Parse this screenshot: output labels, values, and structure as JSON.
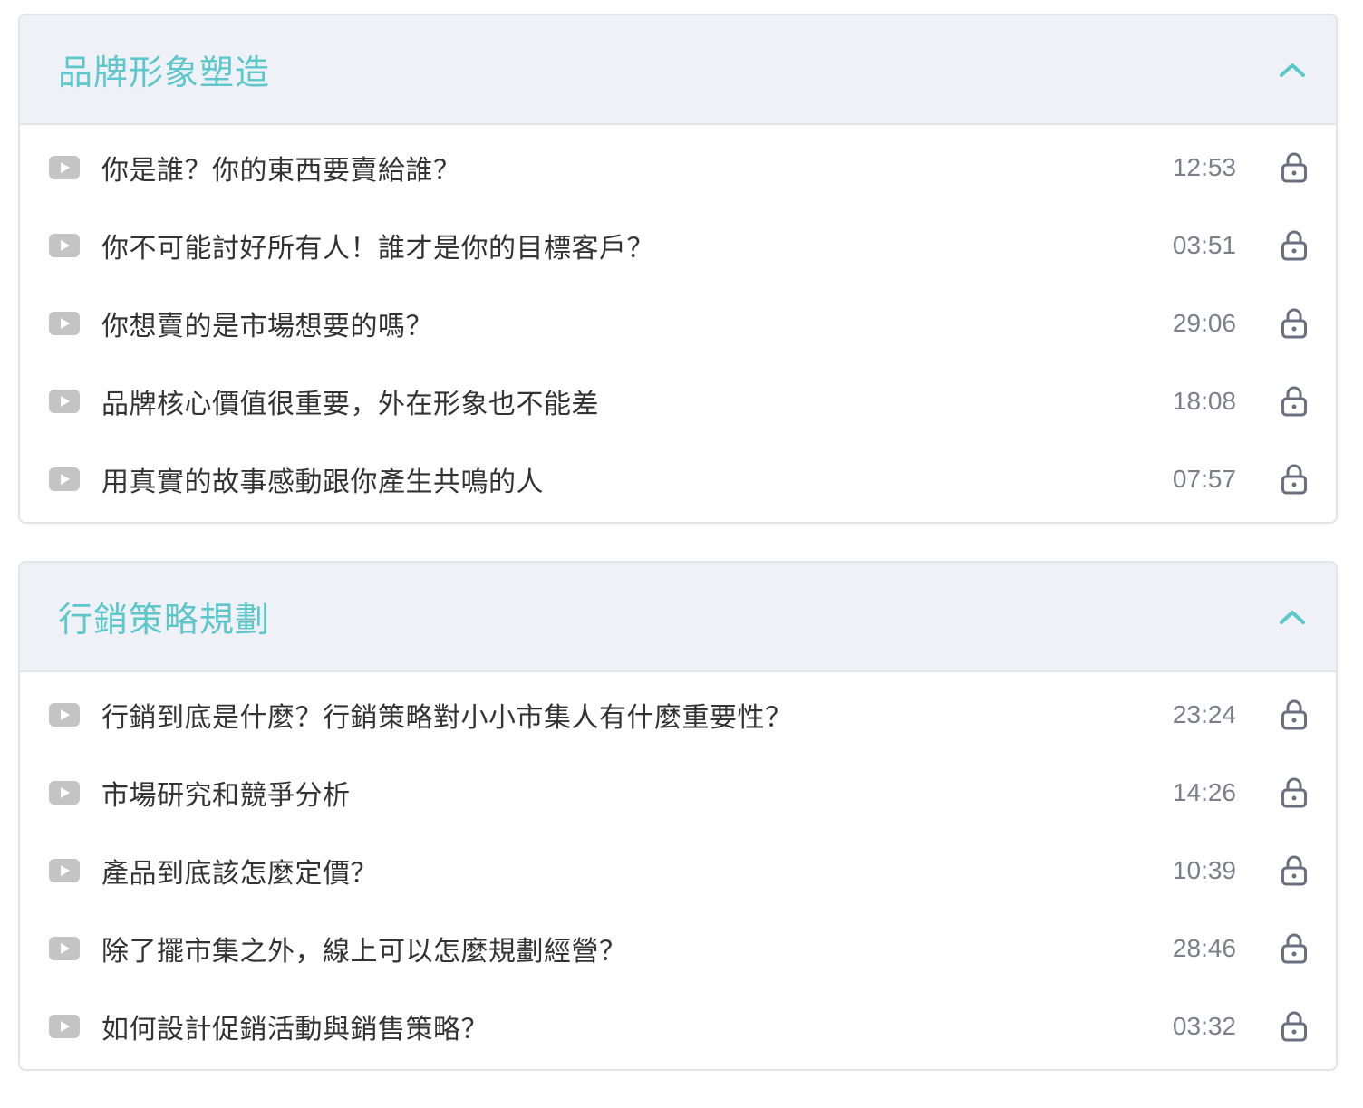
{
  "sections": [
    {
      "title": "品牌形象塑造",
      "collapse_icon": "chevron-up-icon",
      "lessons": [
        {
          "title": "你是誰？你的東西要賣給誰？",
          "duration": "12:53"
        },
        {
          "title": "你不可能討好所有人！誰才是你的目標客戶？",
          "duration": "03:51"
        },
        {
          "title": "你想賣的是市場想要的嗎？",
          "duration": "29:06"
        },
        {
          "title": "品牌核心價值很重要，外在形象也不能差",
          "duration": "18:08"
        },
        {
          "title": "用真實的故事感動跟你產生共鳴的人",
          "duration": "07:57"
        }
      ]
    },
    {
      "title": "行銷策略規劃",
      "collapse_icon": "chevron-up-icon",
      "lessons": [
        {
          "title": "行銷到底是什麼？行銷策略對小小市集人有什麼重要性？",
          "duration": "23:24"
        },
        {
          "title": "市場研究和競爭分析",
          "duration": "14:26"
        },
        {
          "title": "產品到底該怎麼定價？",
          "duration": "10:39"
        },
        {
          "title": "除了擺市集之外，線上可以怎麼規劃經營？",
          "duration": "28:46"
        },
        {
          "title": "如何設計促銷活動與銷售策略？",
          "duration": "03:32"
        }
      ]
    }
  ],
  "icons": {
    "lesson_type": "play-video-icon",
    "lesson_status": "lock-icon"
  },
  "colors": {
    "accent": "#5cc8cb",
    "header_bg": "#f0f1f6",
    "border": "#e2e4ea",
    "text": "#333333",
    "muted": "#7a7f8a",
    "icon_gray": "#c4c4c4"
  }
}
